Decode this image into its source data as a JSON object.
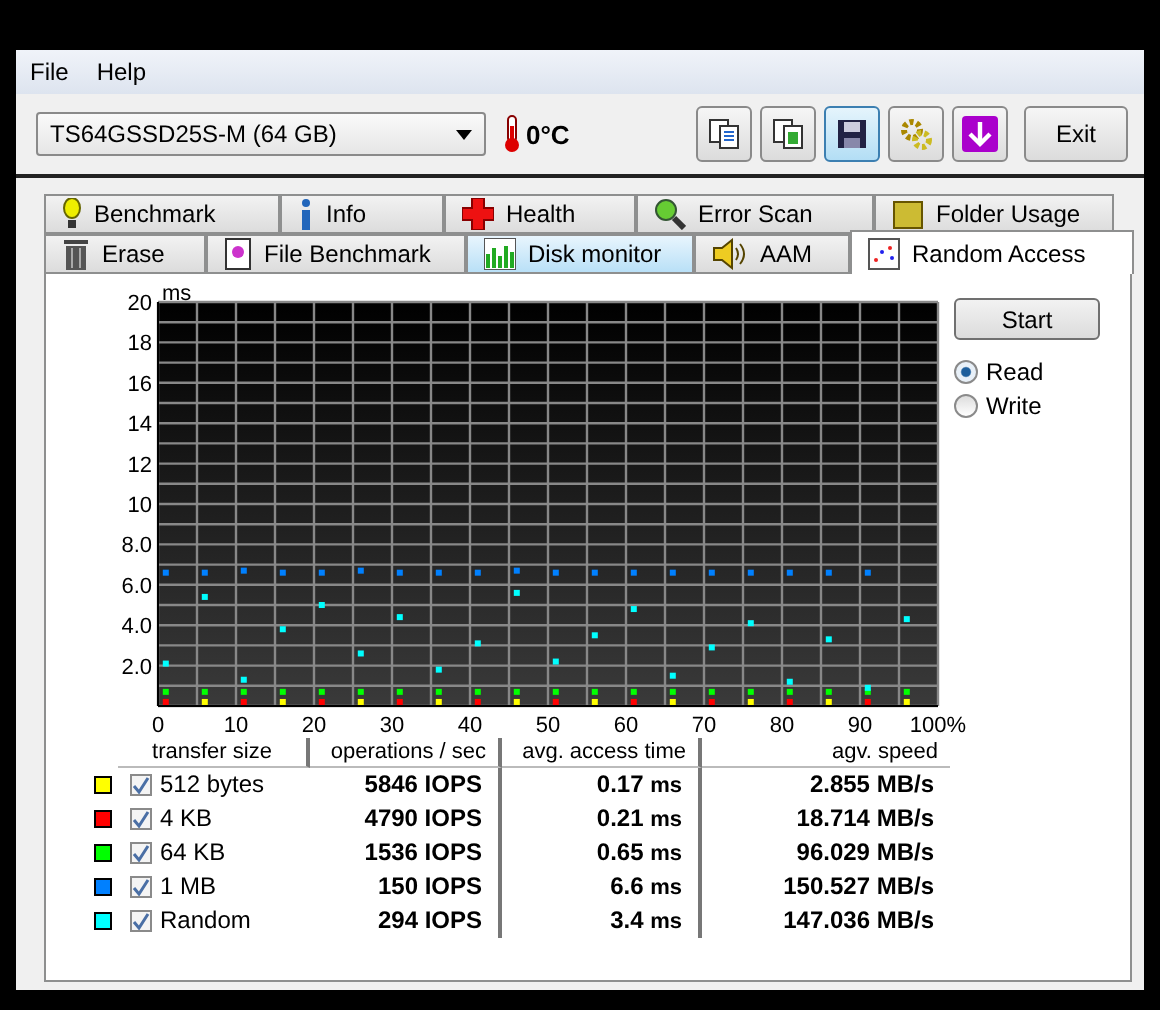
{
  "menu": [
    {
      "label": "File"
    },
    {
      "label": "Help"
    }
  ],
  "toolbar": {
    "drive": "TS64GSSD25S-M (64 GB)",
    "temperature": "0°C",
    "icon_buttons": [
      {
        "kind": "copy",
        "selected": false
      },
      {
        "kind": "copy-color",
        "selected": false
      },
      {
        "kind": "save",
        "selected": true
      },
      {
        "kind": "options",
        "selected": false
      },
      {
        "kind": "download",
        "selected": false
      }
    ],
    "exit": "Exit"
  },
  "tab_rows": [
    [
      {
        "label": "Benchmark",
        "selected": false,
        "hovered": false
      },
      {
        "label": "Info",
        "selected": false,
        "hovered": false
      },
      {
        "label": "Health",
        "selected": false,
        "hovered": false
      },
      {
        "label": "Error Scan",
        "selected": false,
        "hovered": false
      },
      {
        "label": "Folder Usage",
        "selected": false,
        "hovered": false
      }
    ],
    [
      {
        "label": "Erase",
        "selected": false,
        "hovered": false
      },
      {
        "label": "File Benchmark",
        "selected": false,
        "hovered": false
      },
      {
        "label": "Disk monitor",
        "selected": false,
        "hovered": true
      },
      {
        "label": "AAM",
        "selected": false,
        "hovered": false
      },
      {
        "label": "Random Access",
        "selected": true,
        "hovered": false
      }
    ]
  ],
  "chart_data": {
    "type": "scatter",
    "grid": true,
    "ylabel": "ms",
    "xlim": [
      0,
      100
    ],
    "ylim": [
      0,
      20
    ],
    "xticks": [
      0,
      10,
      20,
      30,
      40,
      50,
      60,
      70,
      80,
      90,
      {
        "value": 100,
        "label": "100%"
      }
    ],
    "yticks": [
      {
        "value": 2,
        "label": "2.0"
      },
      {
        "value": 4,
        "label": "4.0"
      },
      {
        "value": 6,
        "label": "6.0"
      },
      {
        "value": 8,
        "label": "8.0"
      },
      10,
      12,
      14,
      16,
      18,
      20
    ],
    "x": [
      1,
      6,
      11,
      16,
      21,
      26,
      31,
      36,
      41,
      46,
      51,
      56,
      61,
      66,
      71,
      76,
      81,
      86,
      91,
      96
    ],
    "series": [
      {
        "color": "#ffff00",
        "values": [
          null,
          0.2,
          null,
          0.2,
          null,
          0.2,
          null,
          0.2,
          null,
          0.2,
          null,
          0.2,
          null,
          0.2,
          null,
          0.2,
          null,
          0.2,
          null,
          0.2
        ]
      },
      {
        "color": "#ff0000",
        "values": [
          0.2,
          null,
          0.2,
          null,
          0.2,
          null,
          0.2,
          null,
          0.2,
          null,
          0.2,
          null,
          0.2,
          null,
          0.2,
          null,
          0.2,
          null,
          0.2,
          null
        ]
      },
      {
        "color": "#00ff00",
        "values": [
          0.7,
          0.7,
          0.7,
          0.7,
          0.7,
          0.7,
          0.7,
          0.7,
          0.7,
          0.7,
          0.7,
          0.7,
          0.7,
          0.7,
          0.7,
          0.7,
          0.7,
          0.7,
          0.7,
          0.7
        ]
      },
      {
        "color": "#0080ff",
        "values": [
          6.6,
          6.6,
          6.7,
          6.6,
          6.6,
          6.7,
          6.6,
          6.6,
          6.6,
          6.7,
          6.6,
          6.6,
          6.6,
          6.6,
          6.6,
          6.6,
          6.6,
          6.6,
          6.6,
          null
        ]
      },
      {
        "color": "#00ffff",
        "values": [
          2.1,
          5.4,
          1.3,
          3.8,
          5.0,
          2.6,
          4.4,
          1.8,
          3.1,
          5.6,
          2.2,
          3.5,
          4.8,
          1.5,
          2.9,
          4.1,
          1.2,
          3.3,
          0.9,
          4.3
        ]
      }
    ]
  },
  "mode": [
    {
      "label": "Read",
      "selected": true
    },
    {
      "label": "Write",
      "selected": false
    }
  ],
  "start": "Start",
  "table": {
    "columns": [
      "transfer size",
      "operations / sec",
      "avg. access time",
      "agv. speed"
    ],
    "rows": [
      {
        "color": "#ffff00",
        "checked": true,
        "size": "512 bytes",
        "ops": "5846 IOPS",
        "time": "0.17",
        "unit": "ms",
        "speed": "2.855 MB/s"
      },
      {
        "color": "#ff0000",
        "checked": true,
        "size": "4 KB",
        "ops": "4790 IOPS",
        "time": "0.21",
        "unit": "ms",
        "speed": "18.714 MB/s"
      },
      {
        "color": "#00ff00",
        "checked": true,
        "size": "64 KB",
        "ops": "1536 IOPS",
        "time": "0.65",
        "unit": "ms",
        "speed": "96.029 MB/s"
      },
      {
        "color": "#0080ff",
        "checked": true,
        "size": "1 MB",
        "ops": "150 IOPS",
        "time": "6.6",
        "unit": "ms",
        "speed": "150.527 MB/s"
      },
      {
        "color": "#00ffff",
        "checked": true,
        "size": "Random",
        "ops": "294 IOPS",
        "time": "3.4",
        "unit": "ms",
        "speed": "147.036 MB/s"
      }
    ]
  }
}
